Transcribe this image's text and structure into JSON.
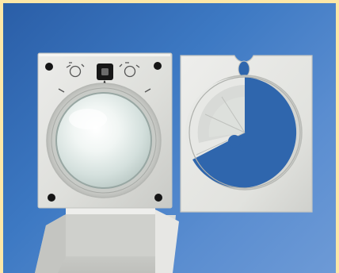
{
  "image": {
    "subject": "motion-sensor",
    "colors": {
      "background": "#2f66ad",
      "frame": "#fde7a7",
      "plate": "#dfe0dc",
      "plate_shadow": "#b8bab6",
      "lens": "#dfe9e6"
    }
  }
}
